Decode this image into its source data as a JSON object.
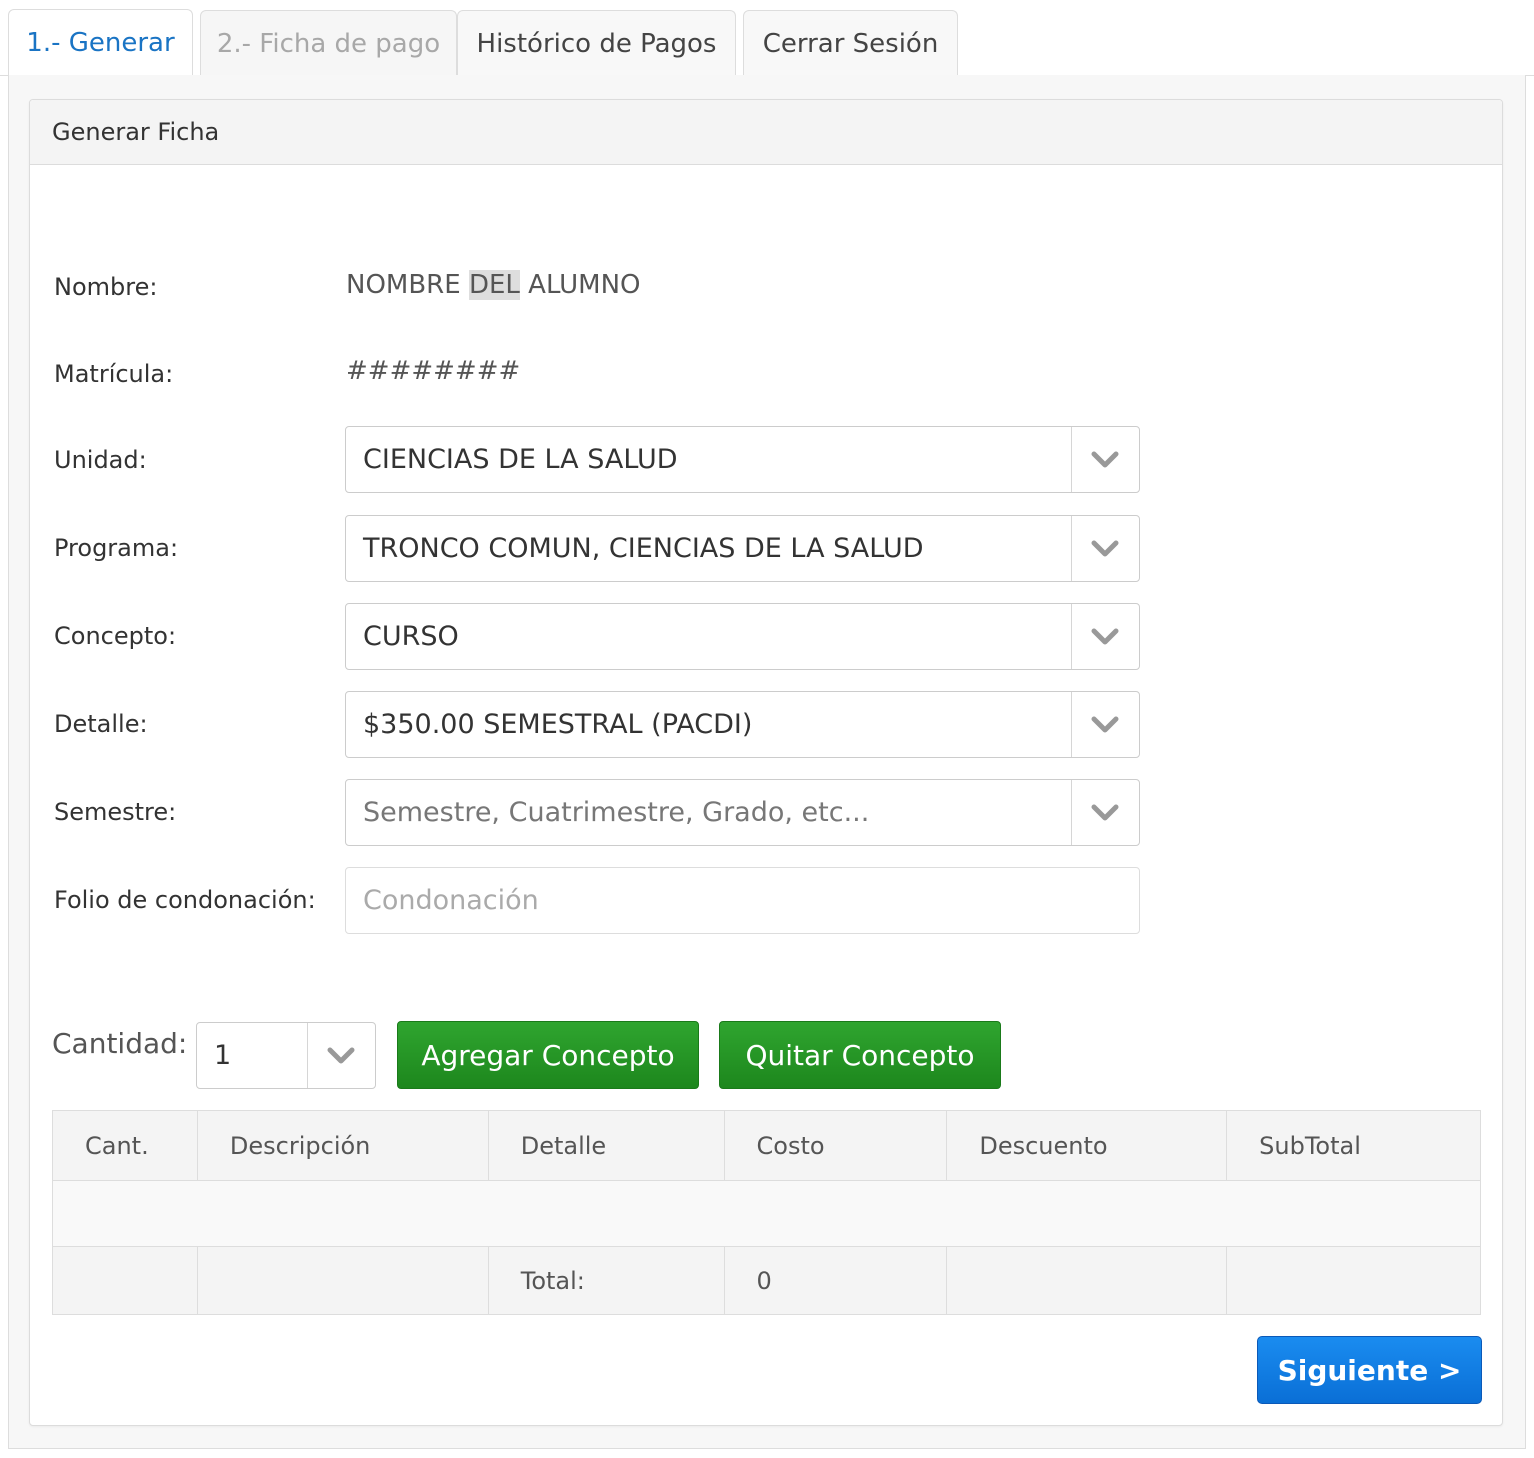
{
  "tabs": [
    {
      "label": "1.- Generar",
      "state": "active"
    },
    {
      "label": "2.- Ficha de pago",
      "state": "disabled"
    },
    {
      "label": "Histórico de Pagos",
      "state": "normal"
    },
    {
      "label": "Cerrar Sesión",
      "state": "normal"
    }
  ],
  "panel": {
    "title": "Generar Ficha"
  },
  "form": {
    "nombre_label": "Nombre:",
    "nombre_pre": "NOMBRE ",
    "nombre_hl": "DEL",
    "nombre_post": " ALUMNO",
    "matricula_label": "Matrícula:",
    "matricula_value": "########",
    "unidad_label": "Unidad:",
    "unidad_value": "CIENCIAS DE LA SALUD",
    "programa_label": "Programa:",
    "programa_value": "TRONCO COMUN, CIENCIAS DE LA SALUD",
    "concepto_label": "Concepto:",
    "concepto_value": "CURSO",
    "detalle_label": "Detalle:",
    "detalle_value": "$350.00 SEMESTRAL (PACDI)",
    "semestre_label": "Semestre:",
    "semestre_placeholder": "Semestre, Cuatrimestre, Grado, etc...",
    "folio_label": "Folio de condonación:",
    "folio_placeholder": "Condonación"
  },
  "cantidad": {
    "label": "Cantidad:",
    "value": "1"
  },
  "buttons": {
    "agregar": "Agregar Concepto",
    "quitar": "Quitar Concepto",
    "siguiente": "Siguiente >"
  },
  "table": {
    "headers": [
      "Cant.",
      "Descripción",
      "Detalle",
      "Costo",
      "Descuento",
      "SubTotal"
    ],
    "total_label": "Total:",
    "total_value": "0"
  },
  "colors": {
    "accent": "#1a74c4",
    "green": "#1d871d",
    "blue": "#0a6fd6"
  },
  "icons": {
    "select_chevron": "chevron-down-icon"
  }
}
